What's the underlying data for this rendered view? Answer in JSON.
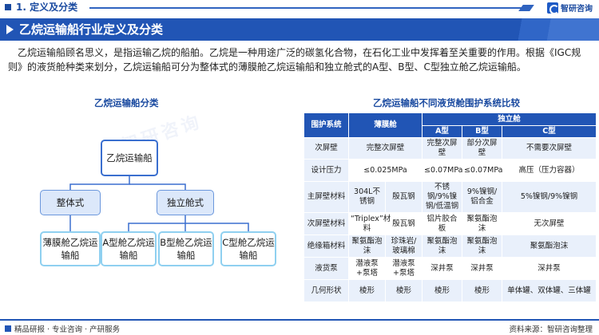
{
  "header": {
    "section": "1. 定义及分类",
    "brand": "智研咨询"
  },
  "title": "乙烷运输船行业定义及分类",
  "description": "乙烷运输船顾名思义，是指运输乙烷的船舶。乙烷是一种用途广泛的碳氢化合物，在石化工业中发挥着至关重要的作用。根据《IGC规则》的液货舱种类来划分，乙烷运输船可分为整体式的薄膜舱乙烷运输船和独立舱式的A型、B型、C型独立舱乙烷运输船。",
  "diagram": {
    "title": "乙烷运输船分类",
    "root": "乙烷运输船",
    "groups": [
      {
        "label": "整体式",
        "children": [
          "薄膜舱乙烷运输船"
        ]
      },
      {
        "label": "独立舱式",
        "children": [
          "A型舱乙烷运输船",
          "B型舱乙烷运输船",
          "C型舱乙烷运输船"
        ]
      }
    ]
  },
  "table": {
    "title": "乙烷运输船不同液货舱围护系统比较",
    "header": {
      "col1": "围护系统",
      "col2": "薄膜舱",
      "col3": "独立舱",
      "sub": [
        "A型",
        "B型",
        "C型"
      ]
    },
    "rows": [
      {
        "label": "次屏壁",
        "cells": [
          "完整次屏壁",
          "完整次屏壁",
          "部分次屏壁",
          "不需要次屏壁"
        ]
      },
      {
        "label": "设计压力",
        "cells": [
          "≤0.025MPa",
          "≤0.07MPa",
          "≤0.07MPa",
          "高压（压力容器）"
        ]
      },
      {
        "label": "主屏壁材料",
        "cells": [
          "304L不锈钢",
          "殷瓦钢",
          "不锈钢/9%镍钢/低温钢",
          "9%镍钢/铝合金",
          "5%镍钢/9%镍钢"
        ]
      },
      {
        "label": "次屏壁材料",
        "cells": [
          "“Triplex”材料",
          "殷瓦钢",
          "铝片胶合板",
          "聚氨酯泡沫",
          "无次屏壁"
        ]
      },
      {
        "label": "绝缘箱材料",
        "cells": [
          "聚氨酯泡沫",
          "珍珠岩/玻璃棉",
          "聚氨酯泡沫",
          "聚氨酯泡沫",
          "聚氨酯泡沫"
        ]
      },
      {
        "label": "液货泵",
        "cells": [
          "潜液泵+泵塔",
          "潜液泵+泵塔",
          "深井泵",
          "深井泵",
          "深井泵"
        ]
      },
      {
        "label": "几何形状",
        "cells": [
          "棱形",
          "棱形",
          "棱形",
          "棱形",
          "单体罐、双体罐、三体罐"
        ]
      }
    ]
  },
  "footer": {
    "left": "精品研报 · 专业咨询 · 产研服务",
    "right": "资料来源：智研咨询整理"
  },
  "watermark": "智研咨询",
  "colors": {
    "primary": "#2155b5",
    "light": "#e9f0fb",
    "leaf_border": "#8fd0f0"
  }
}
